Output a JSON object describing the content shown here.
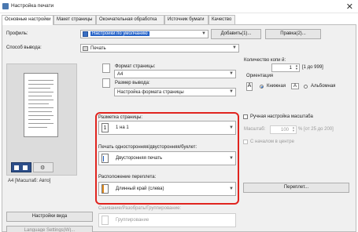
{
  "window": {
    "title": "Настройка печати",
    "close_glyph": "✕"
  },
  "tabs": [
    {
      "label": "Основные настройки"
    },
    {
      "label": "Макет страницы"
    },
    {
      "label": "Окончательная обработка"
    },
    {
      "label": "Источник бумаги"
    },
    {
      "label": "Качество"
    }
  ],
  "profile": {
    "label": "Профиль:",
    "value": "Настройки по умолчанию",
    "add_label": "Добавить(1)...",
    "edit_label": "Правка(2)..."
  },
  "output": {
    "label": "Способ вывода:",
    "value": "Печать"
  },
  "page_format": {
    "label": "Формат страницы:",
    "value": "A4"
  },
  "output_size": {
    "label": "Размер вывода:",
    "value": "Настройка формата страницы"
  },
  "copies": {
    "label": "Количество копи й:",
    "value": "1",
    "range": "[1 до 999]"
  },
  "orientation": {
    "label": "Ориентация",
    "portrait": "Книжная",
    "landscape": "Альбомная",
    "portrait_icon": "A",
    "landscape_icon": "A"
  },
  "layout": {
    "label": "Разметка страницы:",
    "value": "1 на 1",
    "icon_text": "1"
  },
  "duplex": {
    "label": "Печать односторонняя/двусторонняя/буклет:",
    "value": "Двусторонняя печать"
  },
  "binding": {
    "label": "Расположение переплета:",
    "value": "Длинный край (слева)"
  },
  "scaling": {
    "manual_label": "Ручная настройка масштаба",
    "scale_label": "Масштаб:",
    "scale_value": "100",
    "scale_range": "% [от 25 до 200]",
    "center_label": "С началом в центре"
  },
  "binding_button": "Переплет...",
  "collate": {
    "label": "Сшивание/Разобрать/Группирование:",
    "value": "Группирование"
  },
  "preview": {
    "caption": "A4 [Масштаб: Авто]"
  },
  "view_settings_button": "Настройки вида",
  "language_button": "Language Settings(W)..."
}
